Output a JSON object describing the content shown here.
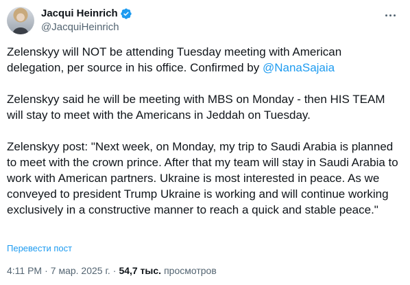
{
  "author": {
    "display_name": "Jacqui Heinrich",
    "handle": "@JacquiHeinrich",
    "verified": true
  },
  "tweet": {
    "para1_text": "Zelenskyy will NOT be attending Tuesday meeting with American delegation, per source in his office. Confirmed by ",
    "para1_mention": "@NanaSajaia",
    "para2_text": "Zelenskyy said he will be meeting with MBS on Monday - then HIS TEAM will stay to meet with the Americans in Jeddah on Tuesday.",
    "para3_text": "Zelenskyy post: \"Next week, on Monday, my trip to Saudi Arabia is planned to meet with the crown prince. After that my team will stay in Saudi Arabia to work with American partners. Ukraine is most interested in peace. As we conveyed to president Trump Ukraine is working and will continue working exclusively in a constructive manner to reach a quick and stable peace.\""
  },
  "translate_label": "Перевести пост",
  "meta": {
    "time": "4:11 PM",
    "separator": "·",
    "date": "7 мар. 2025 г.",
    "views_count": "54,7 тыс.",
    "views_label": "просмотров"
  },
  "icons": {
    "verified": "verified-badge-icon",
    "more": "more-options-icon"
  },
  "colors": {
    "accent": "#1d9bf0",
    "text": "#0f1419",
    "secondary": "#536471"
  }
}
